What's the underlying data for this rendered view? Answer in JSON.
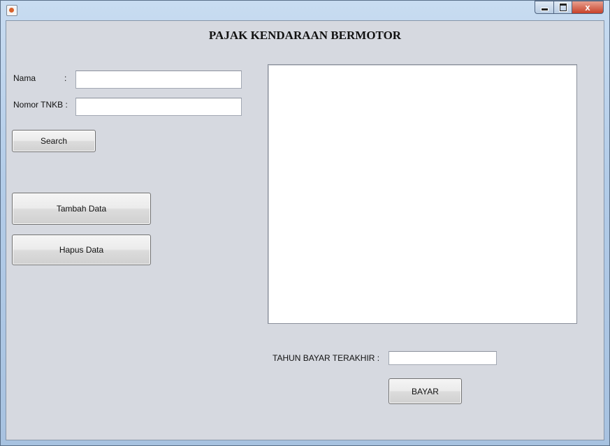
{
  "window": {
    "controls": {
      "minimize": "minimize-icon",
      "maximize": "maximize-icon",
      "close_glyph": "x"
    }
  },
  "form": {
    "title": "PAJAK KENDARAAN BERMOTOR",
    "nama_label": "Nama",
    "nama_colon": ":",
    "nama_value": "",
    "nomor_label": "Nomor TNKB  :",
    "nomor_value": "",
    "search_label": "Search",
    "tambah_label": "Tambah Data",
    "hapus_label": "Hapus Data",
    "tahun_label": "TAHUN BAYAR TERAKHIR :",
    "tahun_value": "",
    "bayar_label": "BAYAR"
  },
  "colors": {
    "panel_bg": "#d6d9e0",
    "output_bg": "#ffffff",
    "close_red": "#c8422a"
  }
}
